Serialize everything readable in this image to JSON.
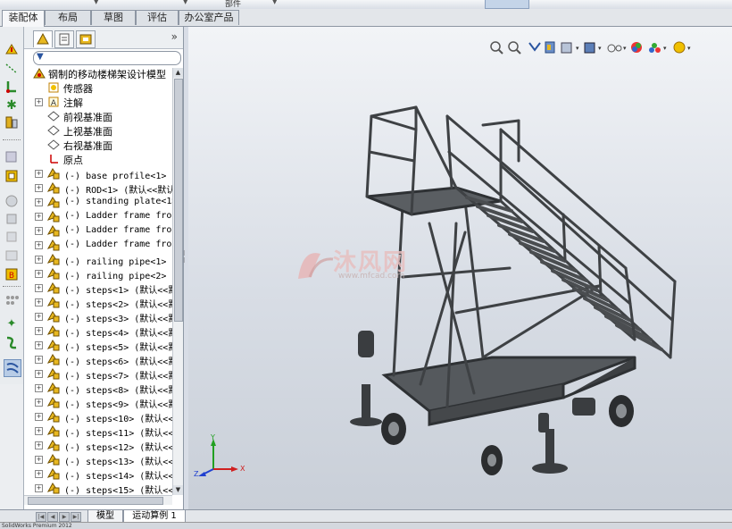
{
  "menu": {
    "top_label": "部件"
  },
  "tabs": [
    {
      "label": "装配体",
      "active": true
    },
    {
      "label": "布局",
      "active": false
    },
    {
      "label": "草图",
      "active": false
    },
    {
      "label": "评估",
      "active": false
    },
    {
      "label": "办公室产品",
      "active": false
    }
  ],
  "left_toolbar": {
    "icons": [
      "mate-icon",
      "linear-pattern-icon",
      "smart-fastener-icon",
      "explode-icon",
      "insert-component-icon",
      "hide-show-icon",
      "move-component-icon",
      "rotate-component-icon",
      "assembly-features-icon",
      "reference-geometry-icon",
      "new-motion-study-icon",
      "bill-of-materials-icon",
      "exploded-view-icon",
      "explode-line-icon",
      "instant3d-icon"
    ]
  },
  "feature_tree": {
    "panel_tabs": [
      "feature-manager-icon",
      "property-manager-icon",
      "configuration-manager-icon"
    ],
    "filter_icon": "filter-icon",
    "collapse_label": "»",
    "root": "钢制的移动楼梯架设计模型",
    "items": [
      {
        "label": "传感器",
        "icon": "sensor-icon",
        "expandable": false
      },
      {
        "label": "注解",
        "icon": "annotation-icon",
        "expandable": true
      },
      {
        "label": "前视基准面",
        "icon": "plane-icon",
        "expandable": false
      },
      {
        "label": "上视基准面",
        "icon": "plane-icon",
        "expandable": false
      },
      {
        "label": "右视基准面",
        "icon": "plane-icon",
        "expandable": false
      },
      {
        "label": "原点",
        "icon": "origin-icon",
        "expandable": false
      },
      {
        "label": "(-) base profile<1> (默",
        "icon": "part-icon",
        "expandable": true
      },
      {
        "label": "(-) ROD<1> (默认<<默认",
        "icon": "part-icon",
        "expandable": true
      },
      {
        "label": "(-) standing plate<1>",
        "icon": "part-icon",
        "expandable": true
      },
      {
        "label": "(-) Ladder frame front",
        "icon": "part-icon",
        "expandable": true
      },
      {
        "label": "(-) Ladder frame front",
        "icon": "part-icon",
        "expandable": true
      },
      {
        "label": "(-) Ladder frame front",
        "icon": "part-icon",
        "expandable": true
      },
      {
        "label": "(-) railing pipe<1> (默",
        "icon": "part-icon",
        "expandable": true
      },
      {
        "label": "(-) railing pipe<2> (默",
        "icon": "part-icon",
        "expandable": true
      },
      {
        "label": "(-) steps<1> (默认<<默",
        "icon": "part-icon",
        "expandable": true
      },
      {
        "label": "(-) steps<2> (默认<<默",
        "icon": "part-icon",
        "expandable": true
      },
      {
        "label": "(-) steps<3> (默认<<默",
        "icon": "part-icon",
        "expandable": true
      },
      {
        "label": "(-) steps<4> (默认<<默",
        "icon": "part-icon",
        "expandable": true
      },
      {
        "label": "(-) steps<5> (默认<<默",
        "icon": "part-icon",
        "expandable": true
      },
      {
        "label": "(-) steps<6> (默认<<默",
        "icon": "part-icon",
        "expandable": true
      },
      {
        "label": "(-) steps<7> (默认<<默",
        "icon": "part-icon",
        "expandable": true
      },
      {
        "label": "(-) steps<8> (默认<<默",
        "icon": "part-icon",
        "expandable": true
      },
      {
        "label": "(-) steps<9> (默认<<默",
        "icon": "part-icon",
        "expandable": true
      },
      {
        "label": "(-) steps<10> (默认<<默",
        "icon": "part-icon",
        "expandable": true
      },
      {
        "label": "(-) steps<11> (默认<<默",
        "icon": "part-icon",
        "expandable": true
      },
      {
        "label": "(-) steps<12> (默认<<默",
        "icon": "part-icon",
        "expandable": true
      },
      {
        "label": "(-) steps<13> (默认<<默",
        "icon": "part-icon",
        "expandable": true
      },
      {
        "label": "(-) steps<14> (默认<<默",
        "icon": "part-icon",
        "expandable": true
      },
      {
        "label": "(-) steps<15> (默认<<默",
        "icon": "part-icon",
        "expandable": true
      }
    ]
  },
  "heads_up_toolbar": [
    "zoom-to-fit-icon",
    "zoom-to-area-icon",
    "previous-view-icon",
    "section-view-icon",
    "view-orientation-icon",
    "display-style-icon",
    "hide-show-items-icon",
    "edit-appearance-icon",
    "apply-scene-icon",
    "view-settings-icon"
  ],
  "watermark": {
    "text": "沐风网",
    "sub": "www.mfcad.com"
  },
  "triad": {
    "x": "X",
    "y": "Y",
    "z": "Z"
  },
  "bottom_tabs": [
    {
      "label": "模型",
      "active": true
    },
    {
      "label": "运动算例 1",
      "active": false
    }
  ],
  "status": {
    "text": "SolidWorks Premium 2012"
  },
  "colors": {
    "accent": "#2a55a0",
    "model": "#4a4d50",
    "viewport_top": "#f2f4f7",
    "viewport_bottom": "#c9cfd8"
  }
}
